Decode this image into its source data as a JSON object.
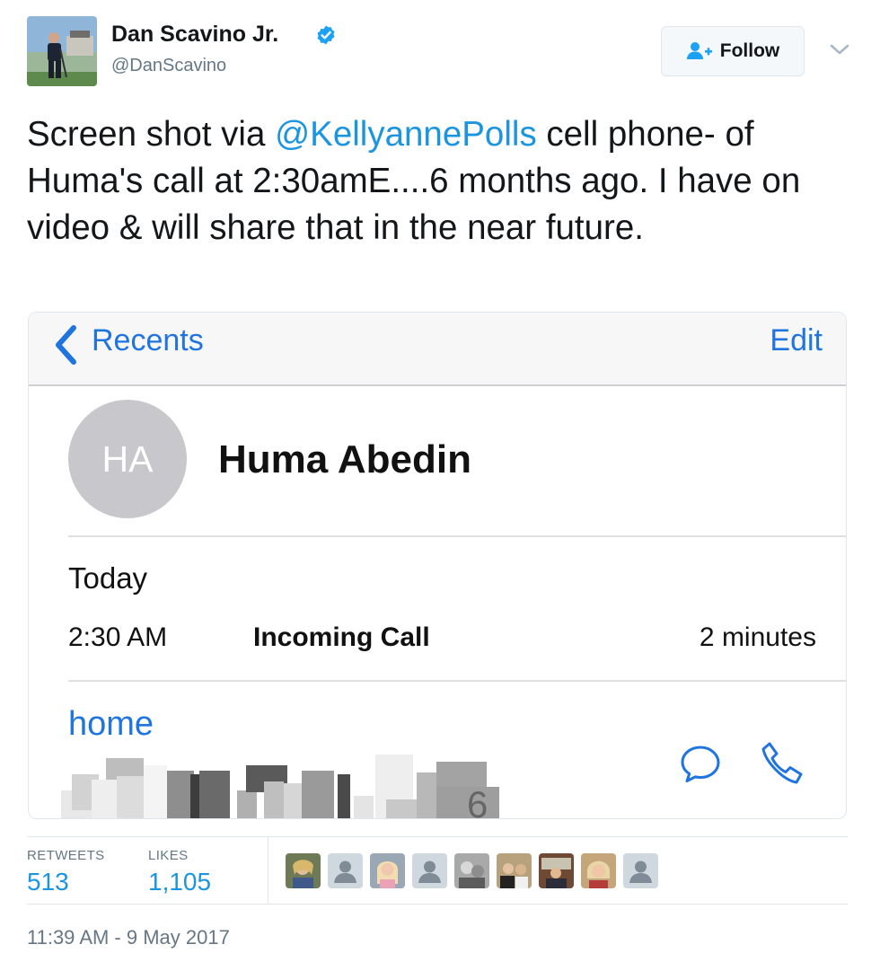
{
  "user": {
    "display_name": "Dan Scavino Jr.",
    "handle": "@DanScavino",
    "verified": true,
    "avatar_icon": "user-avatar-photo"
  },
  "follow_button": {
    "label": "Follow",
    "icon": "add-user-icon"
  },
  "more_icon": "chevron-down-icon",
  "tweet": {
    "text_before": "Screen shot via ",
    "mention": "@KellyannePolls",
    "text_after": " cell phone- of Huma's call at 2:30amE....6 months ago. I have on video & will share that in the near future."
  },
  "media": {
    "back_label": "Recents",
    "edit_label": "Edit",
    "contact_initials": "HA",
    "contact_name": "Huma Abedin",
    "day": "Today",
    "call_time": "2:30 AM",
    "call_type": "Incoming Call",
    "call_duration": "2 minutes",
    "phone_label": "home",
    "redacted_number_digit": "6"
  },
  "stats": {
    "retweets_label": "RETWEETS",
    "retweets": "513",
    "likes_label": "LIKES",
    "likes": "1,105"
  },
  "likers": [
    "photo",
    "default",
    "photo",
    "default",
    "photo",
    "photo",
    "photo",
    "photo",
    "default"
  ],
  "timestamp": "11:39 AM - 9 May 2017",
  "colors": {
    "link": "#1b95e0",
    "ios_blue": "#1f74e0",
    "muted": "#657786",
    "border": "#e1e8ed"
  }
}
